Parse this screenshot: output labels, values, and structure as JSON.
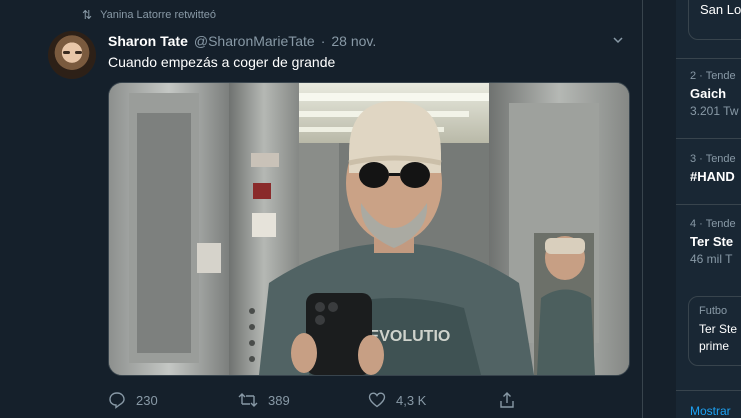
{
  "retweet": {
    "label": "Yanina Latorre retwitteó",
    "icon": "retweet-icon"
  },
  "tweet": {
    "display_name": "Sharon Tate",
    "handle": "@SharonMarieTate",
    "separator": "·",
    "date": "28 nov.",
    "text": "Cuando empezás a coger de grande",
    "image_icon": "selfie-photo",
    "actions": {
      "replies": "230",
      "retweets": "389",
      "likes": "4,3 K"
    }
  },
  "sidebar": {
    "top_text": "San Lo",
    "trends": [
      {
        "meta": "2 · Tende",
        "name": "Gaich",
        "count": "3.201 Tw"
      },
      {
        "meta": "3 · Tende",
        "name": "#HAND",
        "count": ""
      },
      {
        "meta": "4 · Tende",
        "name": "Ter Ste",
        "count": "46 mil T"
      }
    ],
    "card": {
      "meta": "Futbo",
      "line1": "Ter Ste",
      "line2": "prime"
    },
    "show_more": "Mostrar"
  },
  "colors": {
    "background": "#15202b",
    "sidebar": "#192734",
    "border": "#38444d",
    "muted": "#8899a6",
    "accent": "#1da1f2"
  }
}
